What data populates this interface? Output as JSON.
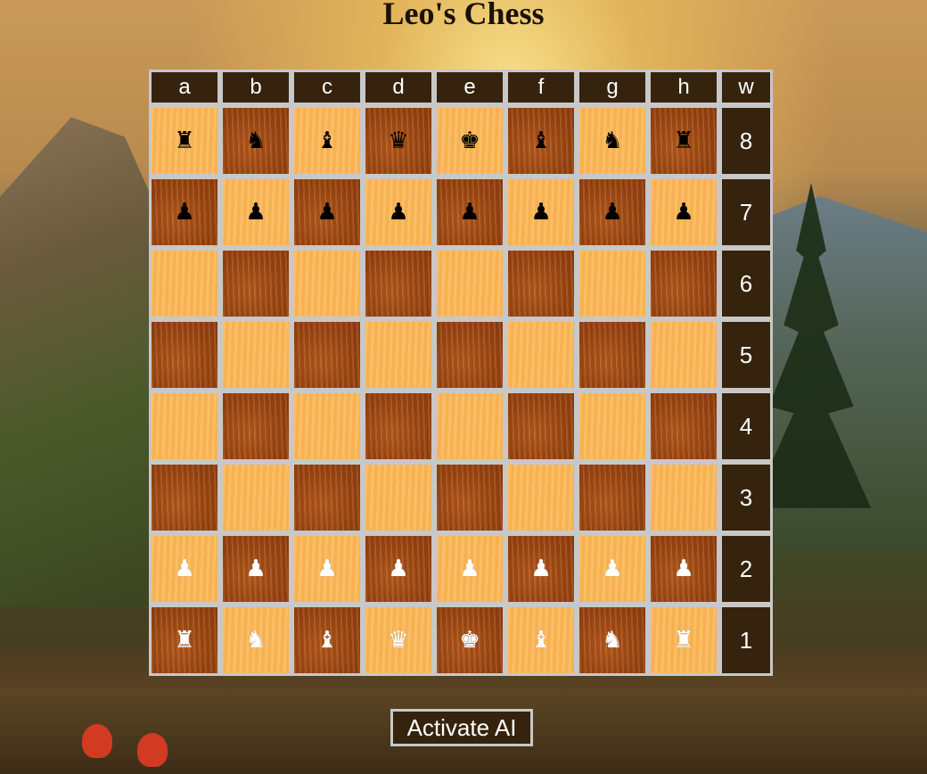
{
  "title": "Leo's Chess",
  "files": [
    "a",
    "b",
    "c",
    "d",
    "e",
    "f",
    "g",
    "h"
  ],
  "turn_indicator": "w",
  "ranks": [
    "8",
    "7",
    "6",
    "5",
    "4",
    "3",
    "2",
    "1"
  ],
  "board": [
    [
      {
        "sq": "a8",
        "color": "black",
        "piece": "rook",
        "glyph": "♜"
      },
      {
        "sq": "b8",
        "color": "black",
        "piece": "knight",
        "glyph": "♞"
      },
      {
        "sq": "c8",
        "color": "black",
        "piece": "bishop",
        "glyph": "♝"
      },
      {
        "sq": "d8",
        "color": "black",
        "piece": "queen",
        "glyph": "♛"
      },
      {
        "sq": "e8",
        "color": "black",
        "piece": "king",
        "glyph": "♚"
      },
      {
        "sq": "f8",
        "color": "black",
        "piece": "bishop",
        "glyph": "♝"
      },
      {
        "sq": "g8",
        "color": "black",
        "piece": "knight",
        "glyph": "♞"
      },
      {
        "sq": "h8",
        "color": "black",
        "piece": "rook",
        "glyph": "♜"
      }
    ],
    [
      {
        "sq": "a7",
        "color": "black",
        "piece": "pawn",
        "glyph": "♟"
      },
      {
        "sq": "b7",
        "color": "black",
        "piece": "pawn",
        "glyph": "♟"
      },
      {
        "sq": "c7",
        "color": "black",
        "piece": "pawn",
        "glyph": "♟"
      },
      {
        "sq": "d7",
        "color": "black",
        "piece": "pawn",
        "glyph": "♟"
      },
      {
        "sq": "e7",
        "color": "black",
        "piece": "pawn",
        "glyph": "♟"
      },
      {
        "sq": "f7",
        "color": "black",
        "piece": "pawn",
        "glyph": "♟"
      },
      {
        "sq": "g7",
        "color": "black",
        "piece": "pawn",
        "glyph": "♟"
      },
      {
        "sq": "h7",
        "color": "black",
        "piece": "pawn",
        "glyph": "♟"
      }
    ],
    [
      {
        "sq": "a6"
      },
      {
        "sq": "b6"
      },
      {
        "sq": "c6"
      },
      {
        "sq": "d6"
      },
      {
        "sq": "e6"
      },
      {
        "sq": "f6"
      },
      {
        "sq": "g6"
      },
      {
        "sq": "h6"
      }
    ],
    [
      {
        "sq": "a5"
      },
      {
        "sq": "b5"
      },
      {
        "sq": "c5"
      },
      {
        "sq": "d5"
      },
      {
        "sq": "e5"
      },
      {
        "sq": "f5"
      },
      {
        "sq": "g5"
      },
      {
        "sq": "h5"
      }
    ],
    [
      {
        "sq": "a4"
      },
      {
        "sq": "b4"
      },
      {
        "sq": "c4"
      },
      {
        "sq": "d4"
      },
      {
        "sq": "e4"
      },
      {
        "sq": "f4"
      },
      {
        "sq": "g4"
      },
      {
        "sq": "h4"
      }
    ],
    [
      {
        "sq": "a3"
      },
      {
        "sq": "b3"
      },
      {
        "sq": "c3"
      },
      {
        "sq": "d3"
      },
      {
        "sq": "e3"
      },
      {
        "sq": "f3"
      },
      {
        "sq": "g3"
      },
      {
        "sq": "h3"
      }
    ],
    [
      {
        "sq": "a2",
        "color": "white",
        "piece": "pawn",
        "glyph": "♟"
      },
      {
        "sq": "b2",
        "color": "white",
        "piece": "pawn",
        "glyph": "♟"
      },
      {
        "sq": "c2",
        "color": "white",
        "piece": "pawn",
        "glyph": "♟"
      },
      {
        "sq": "d2",
        "color": "white",
        "piece": "pawn",
        "glyph": "♟"
      },
      {
        "sq": "e2",
        "color": "white",
        "piece": "pawn",
        "glyph": "♟"
      },
      {
        "sq": "f2",
        "color": "white",
        "piece": "pawn",
        "glyph": "♟"
      },
      {
        "sq": "g2",
        "color": "white",
        "piece": "pawn",
        "glyph": "♟"
      },
      {
        "sq": "h2",
        "color": "white",
        "piece": "pawn",
        "glyph": "♟"
      }
    ],
    [
      {
        "sq": "a1",
        "color": "white",
        "piece": "rook",
        "glyph": "♜"
      },
      {
        "sq": "b1",
        "color": "white",
        "piece": "knight",
        "glyph": "♞"
      },
      {
        "sq": "c1",
        "color": "white",
        "piece": "bishop",
        "glyph": "♝"
      },
      {
        "sq": "d1",
        "color": "white",
        "piece": "queen",
        "glyph": "♛"
      },
      {
        "sq": "e1",
        "color": "white",
        "piece": "king",
        "glyph": "♚"
      },
      {
        "sq": "f1",
        "color": "white",
        "piece": "bishop",
        "glyph": "♝"
      },
      {
        "sq": "g1",
        "color": "white",
        "piece": "knight",
        "glyph": "♞"
      },
      {
        "sq": "h1",
        "color": "white",
        "piece": "rook",
        "glyph": "♜"
      }
    ]
  ],
  "ai_button_label": "Activate AI",
  "colors": {
    "light_square": "#fdb857",
    "dark_square": "#9b4612",
    "header_bg": "#36230d",
    "border": "#c8c8c8"
  }
}
